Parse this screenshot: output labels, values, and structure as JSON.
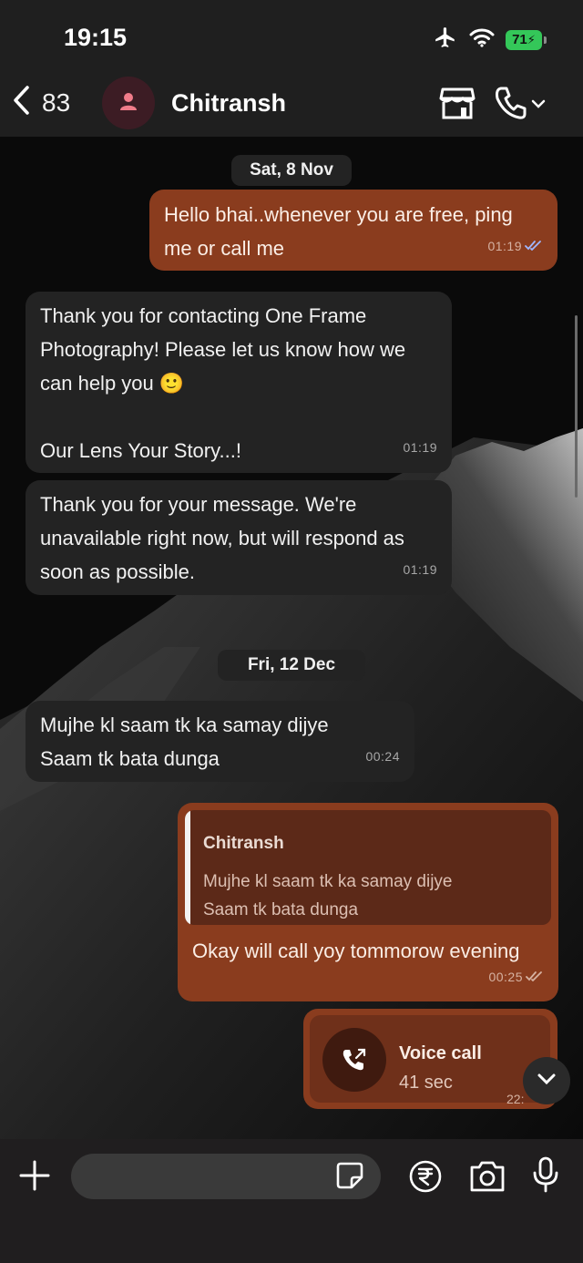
{
  "status_bar": {
    "time": "19:15",
    "battery": "71",
    "icons": [
      "airplane-icon",
      "wifi-icon",
      "battery-charging-icon"
    ]
  },
  "header": {
    "back_count": "83",
    "contact_name": "Chitransh",
    "icons": [
      "back-chevron-icon",
      "person-icon",
      "shop-icon",
      "phone-icon",
      "chevron-down-icon"
    ]
  },
  "chat": {
    "date1": "Sat, 8 Nov",
    "msg1": {
      "text": "Hello bhai..whenever you are free, ping\nme or call me",
      "time": "01:19",
      "direction": "outgoing"
    },
    "msg2": {
      "text": "Thank you for contacting One Frame\nPhotography! Please let us know how we\ncan help you 🙂\n\nOur Lens Your Story...!",
      "time": "01:19",
      "direction": "incoming"
    },
    "msg3": {
      "text": "Thank you for your message. We're\nunavailable right now, but will respond as\nsoon as possible.",
      "time": "01:19",
      "direction": "incoming"
    },
    "date2": "Fri, 12 Dec",
    "msg4": {
      "text": "Mujhe kl saam tk ka samay dijye\nSaam tk bata dunga",
      "time": "00:24",
      "direction": "incoming"
    },
    "msg5": {
      "quote_name": "Chitransh",
      "quote_line1": "Mujhe kl saam tk ka samay dijye",
      "quote_line2": "Saam tk bata dunga",
      "text": "Okay will call yoy tommorow evening",
      "time": "00:25",
      "direction": "outgoing"
    },
    "call": {
      "title": "Voice call",
      "duration": "41 sec",
      "time": "22:"
    }
  },
  "composer": {
    "placeholder": "",
    "icons": [
      "plus-icon",
      "sticker-icon",
      "rupee-icon",
      "camera-icon",
      "microphone-icon"
    ]
  },
  "colors": {
    "outgoing_bubble": "#8a3c1e",
    "incoming_bubble": "#232323",
    "quote_bg": "#5c2918",
    "battery": "#34c759",
    "read_ticks": "#9fb7ff"
  }
}
